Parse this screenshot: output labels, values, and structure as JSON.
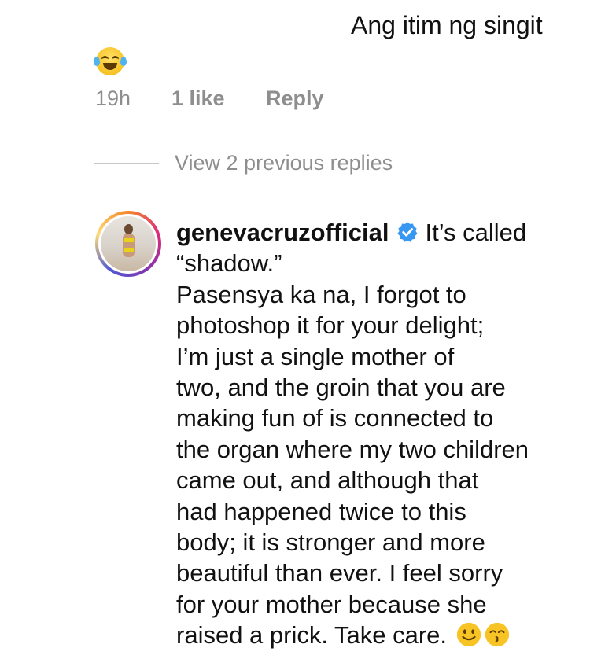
{
  "top_comment": {
    "text": "Ang itim ng singit",
    "emoji": "face-with-tears-of-joy",
    "time": "19h",
    "likes": "1 like",
    "reply_label": "Reply"
  },
  "view_replies": "View 2 previous replies",
  "reply": {
    "username": "genevacruzofficial",
    "verified": true,
    "text": "It’s called “shadow.”\nPasensya ka na, I forgot to photoshop it for your delight; I’m just a single mother of two, and the groin that you are making fun of is connected to the organ where my two children came out, and although that had happened twice to this body; it is stronger and more beautiful than ever. I feel sorry for your mother because she raised a prick. Take care.",
    "lines": [
      "It’s called",
      "“shadow.”",
      "Pasensya ka na, I forgot to",
      "photoshop it for your delight;",
      "I’m just a single mother of",
      "two, and the groin that you are",
      "making fun of is connected to",
      "the organ where my two children",
      "came out, and although that",
      "had happened twice to this",
      "body; it is stronger and more",
      "beautiful than ever. I feel sorry",
      "for your mother because she",
      "raised a prick. Take care."
    ],
    "trailing_emojis": [
      "slightly-smiling-face",
      "kissing-face"
    ]
  },
  "colors": {
    "text": "#111111",
    "muted": "#8e8e8e",
    "verified_blue": "#3897f0"
  }
}
